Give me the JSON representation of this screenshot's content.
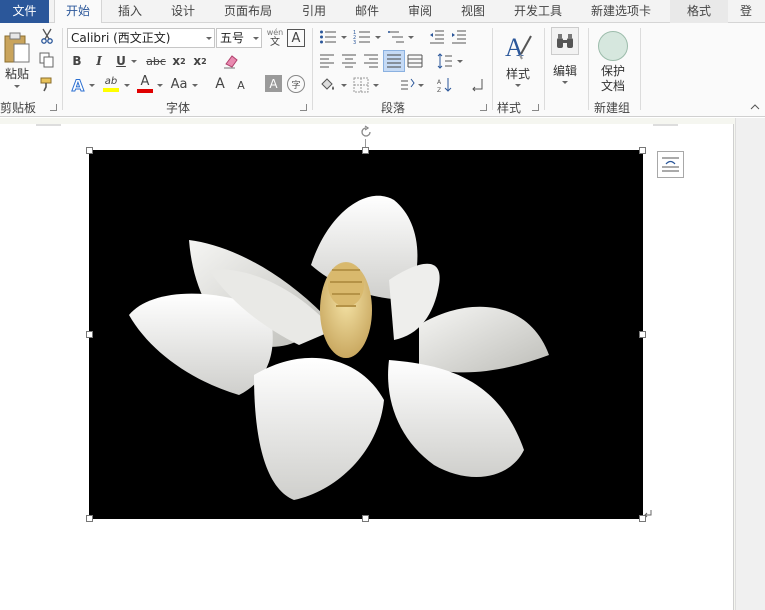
{
  "tabs": [
    {
      "label": "文件"
    },
    {
      "label": "开始"
    },
    {
      "label": "插入"
    },
    {
      "label": "设计"
    },
    {
      "label": "页面布局"
    },
    {
      "label": "引用"
    },
    {
      "label": "邮件"
    },
    {
      "label": "审阅"
    },
    {
      "label": "视图"
    },
    {
      "label": "开发工具"
    },
    {
      "label": "新建选项卡"
    },
    {
      "label": "格式"
    },
    {
      "label": "登"
    }
  ],
  "clipboard": {
    "paste_label": "粘贴",
    "group_label": "剪贴板"
  },
  "font": {
    "name": "Calibri (西文正文)",
    "size": "五号",
    "wen_top": "wén",
    "wen_bottom": "文",
    "border_char": "A",
    "bold": "B",
    "italic": "I",
    "underline": "U",
    "strike": "abc",
    "subscript": "x",
    "subscript_mark": "2",
    "superscript": "x",
    "superscript_mark": "2",
    "grow": "A",
    "shrink": "A",
    "case": "Aa",
    "effects": "A",
    "highlight": "ab",
    "color": "A",
    "shade": "A",
    "enclose": "字",
    "group_label": "字体"
  },
  "paragraph": {
    "group_label": "段落"
  },
  "styles": {
    "label": "样式",
    "group_label": "样式"
  },
  "editing": {
    "label": "编辑"
  },
  "protect": {
    "label_line1": "保护",
    "label_line2": "文档",
    "group_label": "新建组"
  },
  "colors": {
    "accent": "#2b579a",
    "highlight": "#ffff00",
    "font_color": "#e00000"
  }
}
